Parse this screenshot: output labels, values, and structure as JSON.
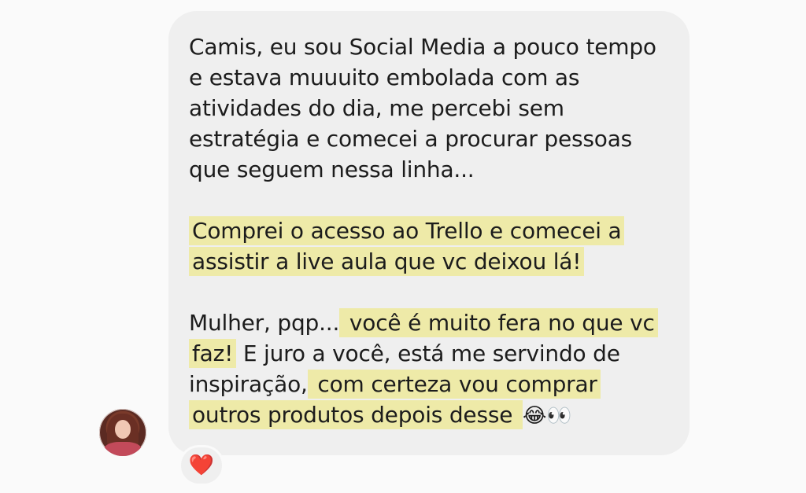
{
  "conversation": {
    "avatar_icon": "user-avatar-photo",
    "message": {
      "paragraph_1": "Camis, eu sou Social Media a pouco tempo e estava muuuito embolada com as atividades do dia, me percebi sem estratégia e comecei a procurar pessoas que seguem nessa linha...",
      "paragraph_2": "Comprei o acesso ao Trello e comecei a assistir a live aula que vc deixou lá!",
      "paragraph_3": {
        "part_1": "Mulher, pqp...",
        "highlight_1": " você é muito fera no que vc faz!",
        "part_2": " E juro a você, está me servindo de inspiração,",
        "highlight_2": " com certeza vou comprar outros produtos depois desse ",
        "emoji_laugh": "😂",
        "emoji_eyes": "👀"
      }
    },
    "reaction": {
      "icon": "heart-icon",
      "glyph": "❤️"
    },
    "colors": {
      "bubble": "#efefef",
      "highlight": "#eeeaa8",
      "background": "#fafafa",
      "text": "#1c1c1c"
    }
  }
}
